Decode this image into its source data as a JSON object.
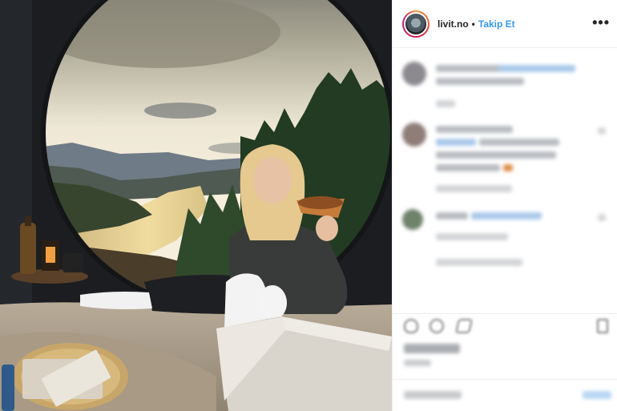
{
  "post": {
    "username": "livit.no",
    "separator": "•",
    "follow_label": "Takip Et",
    "more_label": "•••"
  },
  "photo": {
    "description_icon": "photo-image",
    "colors": {
      "sky": "#efe9dc",
      "lake": "#e6cf96",
      "forest": "#2d4a2a",
      "window_frame": "#141618"
    }
  },
  "colors": {
    "accent": "#3897f0",
    "text": "#262626",
    "divider": "#efefef"
  },
  "icons": {
    "like": "heart-icon",
    "comment": "comment-icon",
    "share": "share-icon",
    "save": "bookmark-icon",
    "more": "ellipsis-icon"
  }
}
